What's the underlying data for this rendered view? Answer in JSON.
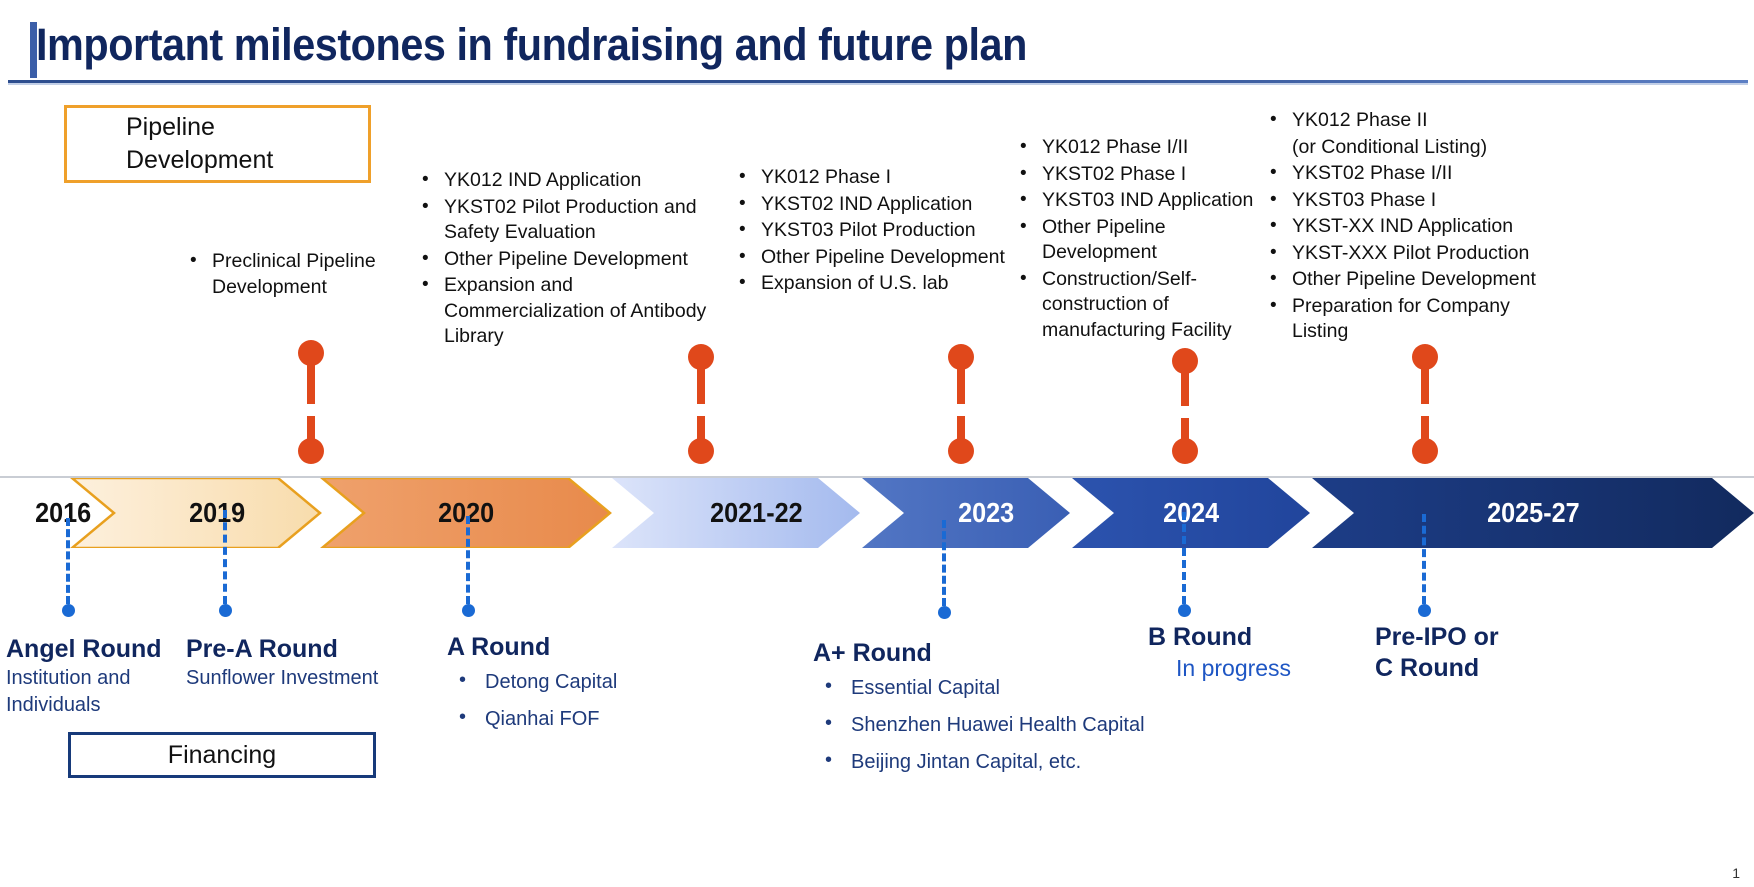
{
  "slide": {
    "title": "Important milestones in fundraising and future plan",
    "page_number": "1"
  },
  "section_labels": {
    "pipeline": "Pipeline\nDevelopment",
    "pipeline_line1": "Pipeline",
    "pipeline_line2": "Development",
    "financing": "Financing"
  },
  "colors": {
    "title": "#10265E",
    "pipeline_box_border": "#EFA02A",
    "financing_box_border": "#173A7A",
    "connector_orange": "#E0481B",
    "dropper_blue": "#1A6AD4",
    "navy_heading": "#10265E",
    "body_blue": "#1E3A7B"
  },
  "timeline": {
    "start_label": "2016",
    "segments": [
      {
        "year": "2019",
        "fill_from": "#FBE7C8",
        "fill_to": "#F7D9A8",
        "stroke": "#E8A01F",
        "text": "dark"
      },
      {
        "year": "2020",
        "fill_from": "#EE9B63",
        "fill_to": "#E98A4C",
        "stroke": "#E8A01F",
        "text": "dark"
      },
      {
        "year": "2021-22",
        "fill_from": "#D6DEF7",
        "fill_to": "#A7BCEF",
        "stroke": "none",
        "text": "dark"
      },
      {
        "year": "2023",
        "fill_from": "#4F72C0",
        "fill_to": "#3B60B4",
        "stroke": "none",
        "text": "light"
      },
      {
        "year": "2024",
        "fill_from": "#2E54AE",
        "fill_to": "#23479F",
        "stroke": "none",
        "text": "light"
      },
      {
        "year": "2025-27",
        "fill_from": "#1C3C85",
        "fill_to": "#142C63",
        "stroke": "none",
        "text": "light"
      }
    ]
  },
  "pipeline_columns": [
    {
      "key": "2019",
      "items": [
        {
          "text": "Preclinical Pipeline Development",
          "bullet": true
        }
      ]
    },
    {
      "key": "2020",
      "items": [
        {
          "text": "YK012 IND Application",
          "bullet": true
        },
        {
          "text": "YKST02 Pilot Production and Safety Evaluation",
          "bullet": true
        },
        {
          "text": "Other Pipeline Development",
          "bullet": true
        },
        {
          "text": "Expansion and Commercialization of Antibody Library",
          "bullet": true
        }
      ]
    },
    {
      "key": "2021-22",
      "items": [
        {
          "text": "YK012 Phase I",
          "bullet": true
        },
        {
          "text": "YKST02 IND Application",
          "bullet": true
        },
        {
          "text": "YKST03 Pilot Production",
          "bullet": true
        },
        {
          "text": "Other Pipeline Development",
          "bullet": true
        },
        {
          "text": "Expansion of U.S. lab",
          "bullet": true
        }
      ]
    },
    {
      "key": "2023",
      "items": [
        {
          "text": "YK012 Phase I/II",
          "bullet": true
        },
        {
          "text": "YKST02 Phase I",
          "bullet": true
        },
        {
          "text": "YKST03 IND Application",
          "bullet": true
        },
        {
          "text": "Other Pipeline Development",
          "bullet": true
        },
        {
          "text": "Construction/Self-construction of manufacturing Facility",
          "bullet": true
        }
      ]
    },
    {
      "key": "2025-27",
      "items": [
        {
          "text": "YK012 Phase II",
          "bullet": true
        },
        {
          "text": "(or Conditional Listing)",
          "bullet": false
        },
        {
          "text": "YKST02 Phase I/II",
          "bullet": true
        },
        {
          "text": "YKST03 Phase I",
          "bullet": true
        },
        {
          "text": "YKST-XX IND Application",
          "bullet": true
        },
        {
          "text": "YKST-XXX Pilot Production",
          "bullet": true
        },
        {
          "text": "Other Pipeline Development",
          "bullet": true
        },
        {
          "text": "Preparation for Company Listing",
          "bullet": true
        }
      ]
    }
  ],
  "financing_rounds": [
    {
      "key": "angel",
      "title": "Angel Round",
      "subtitle": "Institution and Individuals",
      "investors": [],
      "status": ""
    },
    {
      "key": "pre-a",
      "title": "Pre-A Round",
      "subtitle": "Sunflower Investment",
      "investors": [],
      "status": ""
    },
    {
      "key": "a",
      "title": "A Round",
      "subtitle": "",
      "investors": [
        "Detong Capital",
        "Qianhai FOF"
      ],
      "status": ""
    },
    {
      "key": "a-plus",
      "title": "A+ Round",
      "subtitle": "",
      "investors": [
        "Essential Capital",
        "Shenzhen Huawei Health Capital",
        "Beijing Jintan Capital, etc."
      ],
      "status": ""
    },
    {
      "key": "b",
      "title": "B Round",
      "subtitle": "",
      "investors": [],
      "status": "In progress"
    },
    {
      "key": "pre-ipo",
      "title": "Pre-IPO or C Round",
      "title_line1": "Pre-IPO or",
      "title_line2": "C Round",
      "subtitle": "",
      "investors": [],
      "status": ""
    }
  ]
}
